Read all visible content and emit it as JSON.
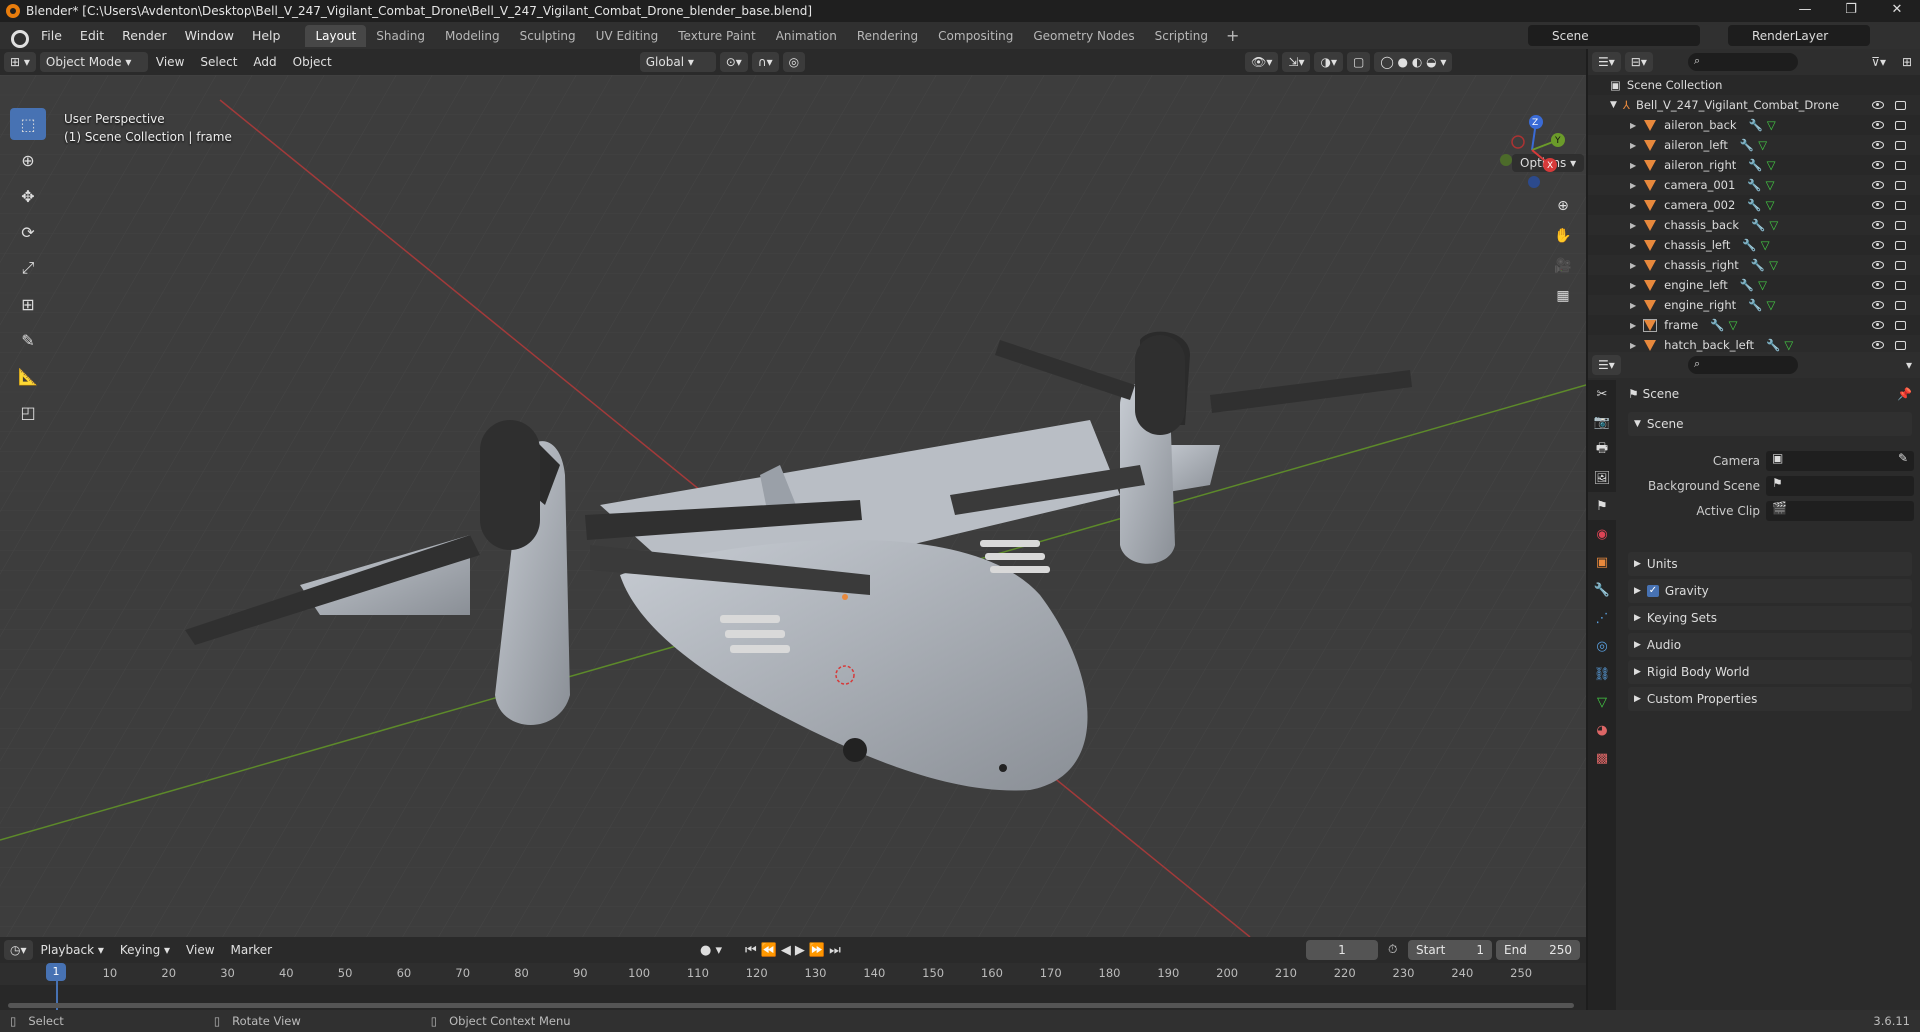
{
  "window": {
    "title": "Blender* [C:\\Users\\Avdenton\\Desktop\\Bell_V_247_Vigilant_Combat_Drone\\Bell_V_247_Vigilant_Combat_Drone_blender_base.blend]",
    "minimize": "—",
    "maximize": "❐",
    "close": "✕"
  },
  "menu": [
    "File",
    "Edit",
    "Render",
    "Window",
    "Help"
  ],
  "workspaces": [
    "Layout",
    "Shading",
    "Modeling",
    "Sculpting",
    "UV Editing",
    "Texture Paint",
    "Animation",
    "Rendering",
    "Compositing",
    "Geometry Nodes",
    "Scripting"
  ],
  "active_workspace": "Layout",
  "scene_name": "Scene",
  "view_layer": "RenderLayer",
  "viewport": {
    "mode": "Object Mode",
    "menus": [
      "View",
      "Select",
      "Add",
      "Object"
    ],
    "orientation": "Global",
    "options": "Options",
    "info_line1": "User Perspective",
    "info_line2": "(1) Scene Collection | frame",
    "gizmo": {
      "x": "X",
      "y": "Y",
      "z": "Z"
    }
  },
  "timeline": {
    "menus": [
      "Playback",
      "Keying",
      "View",
      "Marker"
    ],
    "current_frame": "1",
    "start_label": "Start",
    "start": "1",
    "end_label": "End",
    "end": "250",
    "ruler": [
      "1",
      "10",
      "20",
      "30",
      "40",
      "50",
      "60",
      "70",
      "80",
      "90",
      "100",
      "110",
      "120",
      "130",
      "140",
      "150",
      "160",
      "170",
      "180",
      "190",
      "200",
      "210",
      "220",
      "230",
      "240",
      "250"
    ]
  },
  "status": {
    "select": "Select",
    "rotate": "Rotate View",
    "context": "Object Context Menu",
    "version": "3.6.11"
  },
  "outliner": {
    "root": "Scene Collection",
    "collection": "Bell_V_247_Vigilant_Combat_Drone",
    "objects": [
      "aileron_back",
      "aileron_left",
      "aileron_right",
      "camera_001",
      "camera_002",
      "chassis_back",
      "chassis_left",
      "chassis_right",
      "engine_left",
      "engine_right",
      "frame",
      "hatch_back_left"
    ],
    "selected": "frame"
  },
  "properties": {
    "context": "Scene",
    "panel": "Scene",
    "fields": [
      {
        "label": "Camera"
      },
      {
        "label": "Background Scene"
      },
      {
        "label": "Active Clip"
      }
    ],
    "subpanels": [
      "Units",
      "Gravity",
      "Keying Sets",
      "Audio",
      "Rigid Body World",
      "Custom Properties"
    ],
    "gravity_checked": true
  },
  "colors": {
    "accent": "#4772b3",
    "x_axis": "#b83a3a",
    "y_axis": "#6b9b2a",
    "object_orange": "#e8893d"
  }
}
